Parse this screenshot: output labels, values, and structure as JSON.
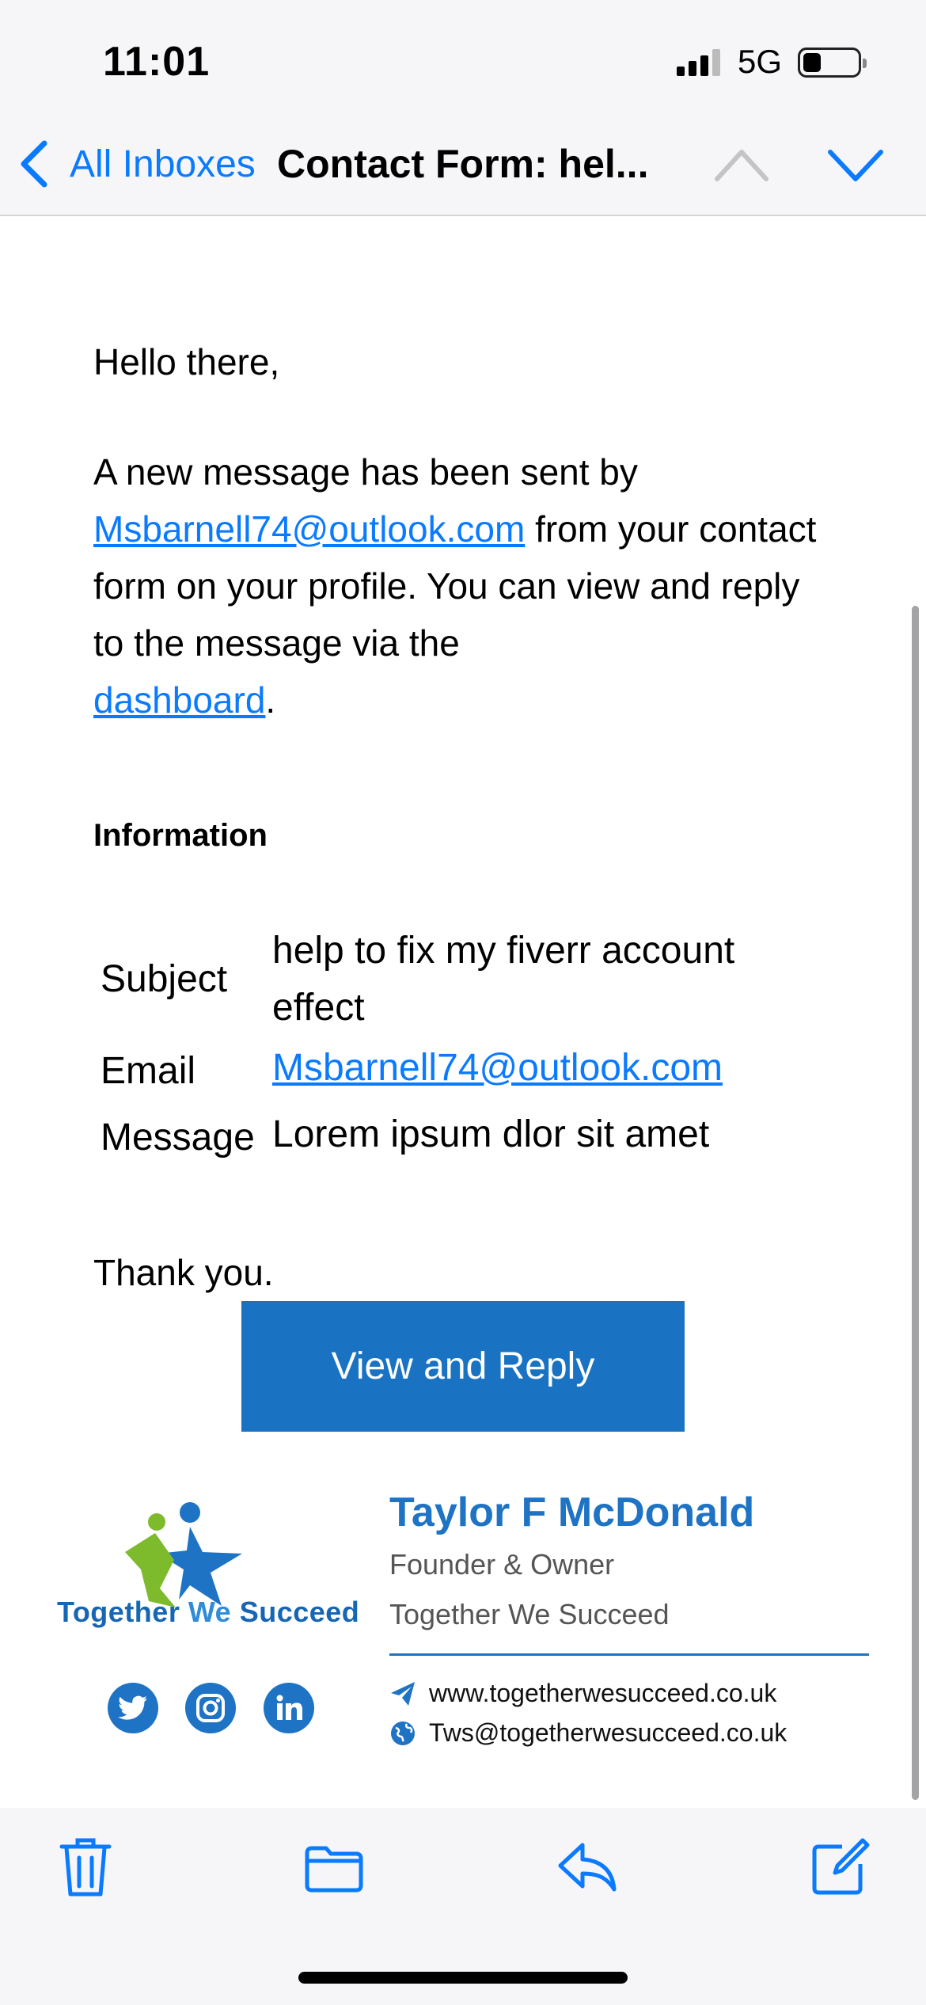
{
  "status_bar": {
    "time": "11:01",
    "network": "5G"
  },
  "nav": {
    "back_label": "All Inboxes",
    "title": "Contact Form: hel..."
  },
  "email": {
    "greeting": "Hello there,",
    "intro_before": "A new message has been sent by",
    "sender_email": "Msbarnell74@outlook.com",
    "intro_middle": "from your contact form on your profile. You can view and reply to the message via the",
    "dashboard_link": "dashboard",
    "intro_end": ".",
    "info_heading": "Information",
    "info": {
      "subject_label": "Subject",
      "subject_value_line1": "help to fix my fiverr account",
      "subject_value_line2": "effect",
      "email_label": "Email",
      "email_value": "Msbarnell74@outlook.com",
      "message_label": "Message",
      "message_value": "Lorem ipsum dlor sit amet"
    },
    "thanks": "Thank you.",
    "cta_label": "View and Reply"
  },
  "signature": {
    "brand_part1": "Together ",
    "brand_part2": "We",
    "brand_part3": " Succeed",
    "name": "Taylor F McDonald",
    "role": "Founder & Owner",
    "company": "Together We Succeed",
    "website": "www.togetherwesucceed.co.uk",
    "contact_email": "Tws@togetherwesucceed.co.uk",
    "social": [
      "twitter-icon",
      "instagram-icon",
      "linkedin-icon"
    ]
  },
  "toolbar": {
    "icons": [
      "trash-icon",
      "folder-icon",
      "reply-icon",
      "compose-icon"
    ]
  },
  "colors": {
    "accent": "#0a7aff",
    "brand_blue": "#1e73c4",
    "button": "#1a73c2",
    "logo_green": "#7dbb2c"
  }
}
